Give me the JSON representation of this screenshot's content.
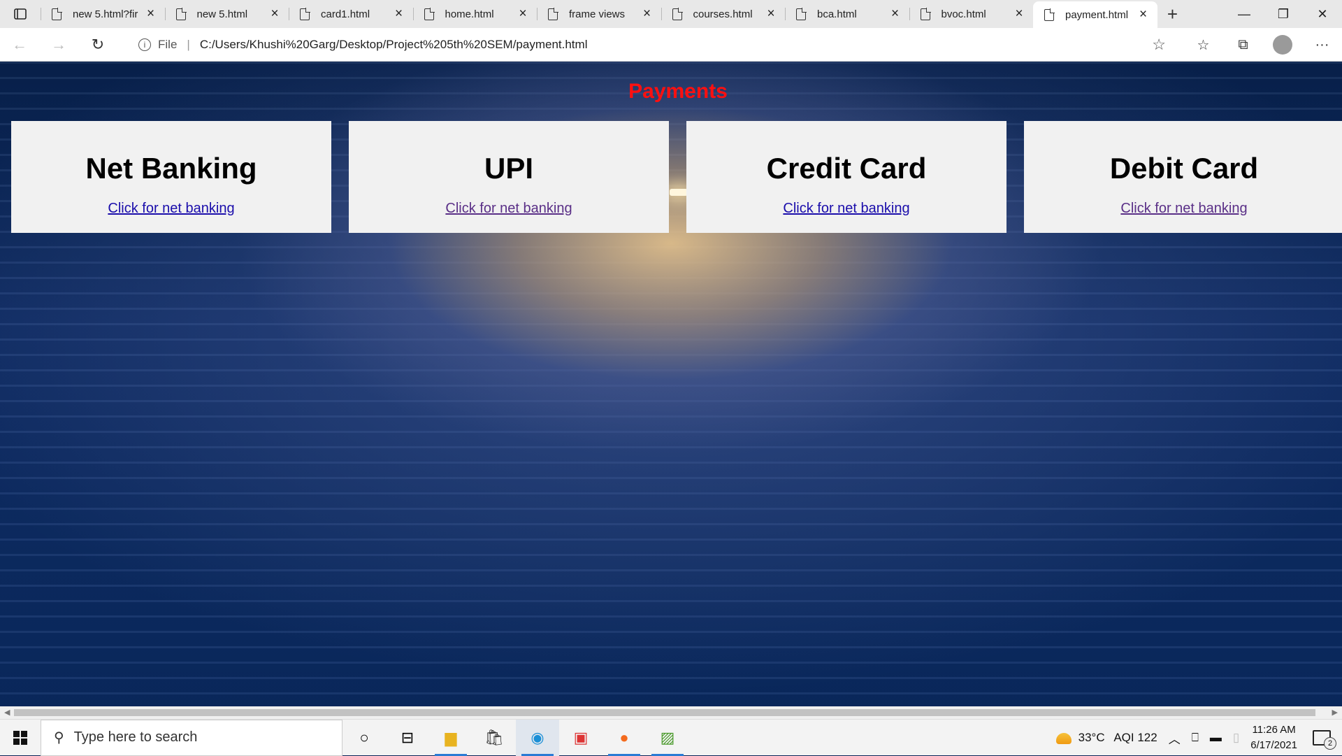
{
  "browser": {
    "tabs": [
      {
        "label": "new 5.html?fir",
        "active": false
      },
      {
        "label": "new 5.html",
        "active": false
      },
      {
        "label": "card1.html",
        "active": false
      },
      {
        "label": "home.html",
        "active": false
      },
      {
        "label": "frame views",
        "active": false
      },
      {
        "label": "courses.html",
        "active": false
      },
      {
        "label": "bca.html",
        "active": false
      },
      {
        "label": "bvoc.html",
        "active": false
      },
      {
        "label": "payment.html",
        "active": true
      }
    ],
    "address": {
      "scheme_label": "File",
      "url": "C:/Users/Khushi%20Garg/Desktop/Project%205th%20SEM/payment.html"
    }
  },
  "page": {
    "title": "Payments",
    "title_color": "#ff1010",
    "cards": [
      {
        "heading": "Net Banking",
        "link": "Click for net banking"
      },
      {
        "heading": "UPI",
        "link": "Click for net banking"
      },
      {
        "heading": "Credit Card",
        "link": "Click for net banking"
      },
      {
        "heading": "Debit Card",
        "link": "Click for net banking"
      }
    ]
  },
  "taskbar": {
    "search_placeholder": "Type here to search",
    "weather": "33°C",
    "aqi": "AQI 122",
    "time": "11:26 AM",
    "date": "6/17/2021",
    "notification_count": "2"
  }
}
